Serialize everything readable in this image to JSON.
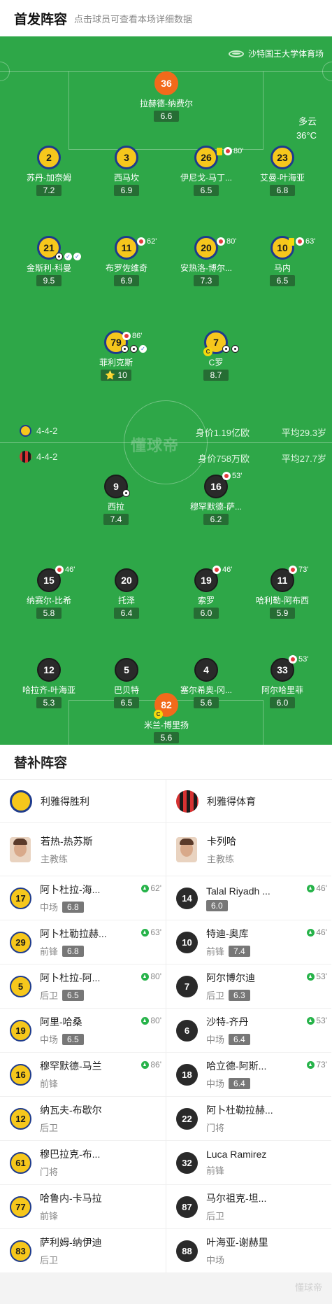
{
  "header": {
    "title": "首发阵容",
    "subtitle": "点击球员可查看本场详细数据"
  },
  "venue": {
    "name": "沙特国王大学体育场",
    "icon": "stadium-icon"
  },
  "weather": {
    "condition": "多云",
    "temp": "36°C"
  },
  "colors": {
    "pitch": "#2ea748",
    "home_shirt": "#f6c71c",
    "home_trim": "#1e3b8c",
    "away_shirt": "#2a2a2a",
    "gk": "#f26a1b"
  },
  "home_lineup": [
    {
      "num": "36",
      "name": "拉赫德-纳费尔",
      "rating": "6.6"
    },
    {
      "num": "2",
      "name": "苏丹-加奈姆",
      "rating": "7.2"
    },
    {
      "num": "3",
      "name": "西马坎",
      "rating": "6.9"
    },
    {
      "num": "26",
      "name": "伊尼戈-马丁...",
      "rating": "6.5",
      "min": "80'"
    },
    {
      "num": "23",
      "name": "艾曼-叶海亚",
      "rating": "6.8"
    },
    {
      "num": "21",
      "name": "金斯利-科曼",
      "rating": "9.5"
    },
    {
      "num": "11",
      "name": "布罗佐维奇",
      "rating": "6.9",
      "min": "62'"
    },
    {
      "num": "20",
      "name": "安热洛-博尔...",
      "rating": "7.3",
      "min": "80'"
    },
    {
      "num": "10",
      "name": "马内",
      "rating": "6.5",
      "min": "63'"
    },
    {
      "num": "79",
      "name": "菲利克斯",
      "rating": "10",
      "min": "86'"
    },
    {
      "num": "7",
      "name": "C罗",
      "rating": "8.7",
      "captain": "C"
    }
  ],
  "home_team": {
    "formation": "4-4-2",
    "value": "身价1.19亿欧",
    "avg_age": "平均29.3岁"
  },
  "away_team": {
    "formation": "4-4-2",
    "value": "身价758万欧",
    "avg_age": "平均27.7岁"
  },
  "watermark": "懂球帝",
  "away_lineup": [
    {
      "num": "9",
      "name": "西拉",
      "rating": "7.4"
    },
    {
      "num": "16",
      "name": "穆罕默德-萨...",
      "rating": "6.2",
      "min": "53'"
    },
    {
      "num": "15",
      "name": "纳赛尔-比希",
      "rating": "5.8",
      "min": "46'"
    },
    {
      "num": "20",
      "name": "托泽",
      "rating": "6.4"
    },
    {
      "num": "19",
      "name": "索罗",
      "rating": "6.0",
      "min": "46'"
    },
    {
      "num": "11",
      "name": "哈利勒-阿布西",
      "rating": "5.9",
      "min": "73'"
    },
    {
      "num": "12",
      "name": "哈拉齐-叶海亚",
      "rating": "5.3"
    },
    {
      "num": "5",
      "name": "巴贝特",
      "rating": "6.5"
    },
    {
      "num": "4",
      "name": "塞尔希奥-冈...",
      "rating": "5.6"
    },
    {
      "num": "33",
      "name": "阿尔哈里菲",
      "rating": "6.0",
      "min": "53'"
    },
    {
      "num": "82",
      "name": "米兰-博里扬",
      "rating": "5.6",
      "captain": "C"
    }
  ],
  "subs": {
    "title": "替补阵容",
    "home": {
      "team": "利雅得胜利",
      "coach": {
        "name": "若热-热苏斯",
        "role": "主教练"
      },
      "players": [
        {
          "num": "17",
          "name": "阿卜杜拉-海...",
          "pos": "中场",
          "rating": "6.8",
          "min": "62'"
        },
        {
          "num": "29",
          "name": "阿卜杜勒拉赫...",
          "pos": "前锋",
          "rating": "6.8",
          "min": "63'"
        },
        {
          "num": "5",
          "name": "阿卜杜拉-阿...",
          "pos": "后卫",
          "rating": "6.5",
          "min": "80'"
        },
        {
          "num": "19",
          "name": "阿里-哈桑",
          "pos": "中场",
          "rating": "6.5",
          "min": "80'"
        },
        {
          "num": "16",
          "name": "穆罕默德-马兰",
          "pos": "前锋",
          "rating": "",
          "min": "86'"
        },
        {
          "num": "12",
          "name": "纳瓦夫-布歇尔",
          "pos": "后卫",
          "rating": "",
          "min": ""
        },
        {
          "num": "61",
          "name": "穆巴拉克-布...",
          "pos": "门将",
          "rating": "",
          "min": ""
        },
        {
          "num": "77",
          "name": "哈鲁内-卡马拉",
          "pos": "前锋",
          "rating": "",
          "min": ""
        },
        {
          "num": "83",
          "name": "萨利姆-纳伊迪",
          "pos": "后卫",
          "rating": "",
          "min": ""
        }
      ]
    },
    "away": {
      "team": "利雅得体育",
      "coach": {
        "name": "卡列哈",
        "role": "主教练"
      },
      "players": [
        {
          "num": "14",
          "name": "Talal Riyadh ...",
          "pos": "",
          "rating": "6.0",
          "min": "46'"
        },
        {
          "num": "10",
          "name": "特迪-奥库",
          "pos": "前锋",
          "rating": "7.4",
          "min": "46'"
        },
        {
          "num": "7",
          "name": "阿尔博尔迪",
          "pos": "后卫",
          "rating": "6.3",
          "min": "53'"
        },
        {
          "num": "6",
          "name": "沙特-齐丹",
          "pos": "中场",
          "rating": "6.4",
          "min": "53'"
        },
        {
          "num": "18",
          "name": "哈立德-阿斯...",
          "pos": "中场",
          "rating": "6.4",
          "min": "73'"
        },
        {
          "num": "22",
          "name": "阿卜杜勒拉赫...",
          "pos": "门将",
          "rating": "",
          "min": ""
        },
        {
          "num": "32",
          "name": "Luca Ramirez",
          "pos": "前锋",
          "rating": "",
          "min": ""
        },
        {
          "num": "87",
          "name": "马尔祖克-坦...",
          "pos": "后卫",
          "rating": "",
          "min": ""
        },
        {
          "num": "88",
          "name": "叶海亚-谢赫里",
          "pos": "中场",
          "rating": "",
          "min": ""
        }
      ]
    }
  }
}
